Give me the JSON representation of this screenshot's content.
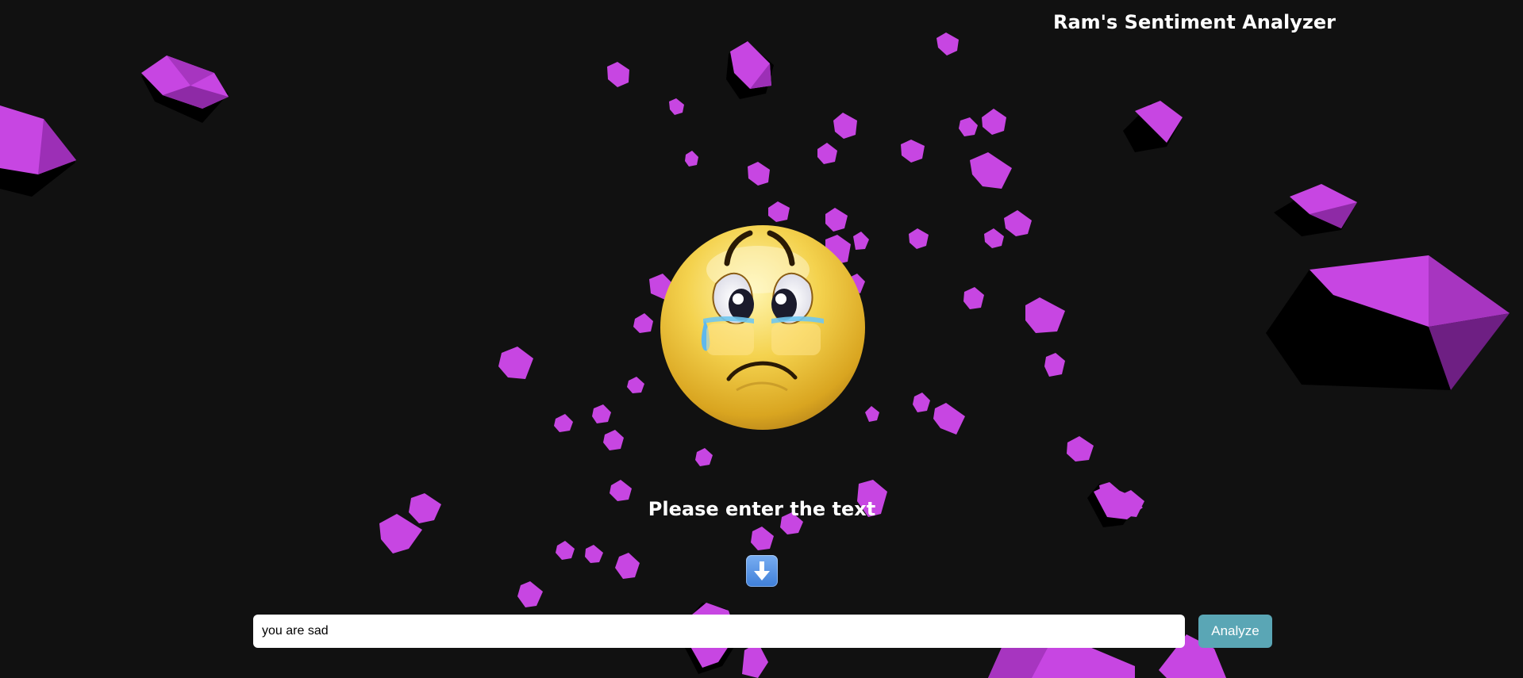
{
  "app": {
    "title": "Ram's Sentiment Analyzer"
  },
  "main": {
    "sentiment_emoji": "crying-face-icon",
    "prompt_text": "Please enter the text",
    "arrow_icon": "down-arrow-icon",
    "input_value": "you are sad",
    "analyze_label": "Analyze"
  },
  "colors": {
    "background": "#111111",
    "crystal": "#c23fe0",
    "button": "#5aa6b5"
  }
}
